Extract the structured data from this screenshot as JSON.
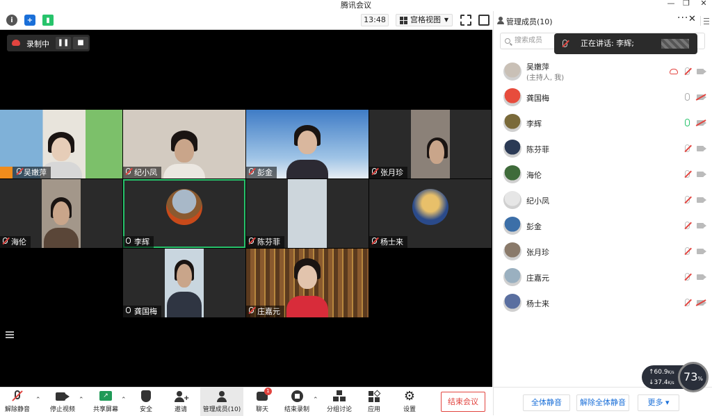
{
  "window": {
    "title": "腾讯会议",
    "controls": [
      "—",
      "❐",
      "✕"
    ]
  },
  "topbar": {
    "time": "13:48",
    "view_label": "宫格视图"
  },
  "recording": {
    "label": "录制中"
  },
  "tiles": [
    {
      "name": "吴嫩萍",
      "mic": "off",
      "bg": "#b7c9d6",
      "body": "#d7d7d7"
    },
    {
      "name": "纪小凤",
      "mic": "off",
      "bg": "#cfc7bd",
      "body": "#e3e0da"
    },
    {
      "name": "彭金",
      "mic": "off",
      "bg": "#4b86c9",
      "body": "#2c2a33"
    },
    {
      "name": "张月珍",
      "mic": "off",
      "bg": "#7f7f7f",
      "body": "#3a3432"
    },
    {
      "name": "海伦",
      "mic": "off",
      "bg": "#9a8f82",
      "body": "#5a4638"
    },
    {
      "name": "李辉",
      "mic": "on",
      "bg": "#2a2a2a",
      "body": "#000"
    },
    {
      "name": "陈芬菲",
      "mic": "off",
      "bg": "#cdd6dc",
      "body": "#cdd6dc"
    },
    {
      "name": "杨士来",
      "mic": "off",
      "bg": "#2a2a2a",
      "body": "#000"
    },
    {
      "name": "龚国梅",
      "mic": "on",
      "bg": "#c9d6df",
      "body": "#2f3542"
    },
    {
      "name": "庄嘉元",
      "mic": "off",
      "bg": "#6b4a2d",
      "body": "#d82c3a"
    }
  ],
  "bottombar": {
    "unmute": "解除静音",
    "stop_video": "停止视频",
    "share_screen": "共享屏幕",
    "security": "安全",
    "invite": "邀请",
    "manage_members": "管理成员(10)",
    "chat": "聊天",
    "chat_badge": "1",
    "stop_recording": "结束录制",
    "breakout": "分组讨论",
    "apps": "应用",
    "settings": "设置",
    "end_meeting": "结束会议"
  },
  "panel": {
    "title": "管理成员(10)",
    "search_placeholder": "搜索成员",
    "speaking": "正在讲话: 李辉;",
    "members": [
      {
        "name": "吴嫩萍",
        "sub": "(主持人, 我)",
        "mic": "off",
        "cam": "plain",
        "rec": true,
        "color": "#c9c0b6"
      },
      {
        "name": "龚国梅",
        "sub": "",
        "mic": "grey",
        "cam": "off",
        "rec": false,
        "color": "#e74c3c"
      },
      {
        "name": "李辉",
        "sub": "",
        "mic": "green",
        "cam": "off",
        "rec": false,
        "color": "#7a6a3a"
      },
      {
        "name": "陈芬菲",
        "sub": "",
        "mic": "off",
        "cam": "plain",
        "rec": false,
        "color": "#2b3a55"
      },
      {
        "name": "海伦",
        "sub": "",
        "mic": "off",
        "cam": "plain",
        "rec": false,
        "color": "#3f6b3a"
      },
      {
        "name": "纪小凤",
        "sub": "",
        "mic": "off",
        "cam": "plain",
        "rec": false,
        "color": "#e6e6e6"
      },
      {
        "name": "彭金",
        "sub": "",
        "mic": "off",
        "cam": "plain",
        "rec": false,
        "color": "#3c6fa8"
      },
      {
        "name": "张月珍",
        "sub": "",
        "mic": "off",
        "cam": "plain",
        "rec": false,
        "color": "#8a7a6a"
      },
      {
        "name": "庄嘉元",
        "sub": "",
        "mic": "off",
        "cam": "plain",
        "rec": false,
        "color": "#9ab0c0"
      },
      {
        "name": "杨士来",
        "sub": "",
        "mic": "off",
        "cam": "off",
        "rec": false,
        "color": "#5a6fa0"
      }
    ],
    "mute_all": "全体静音",
    "unmute_all": "解除全体静音",
    "more": "更多 ▾"
  },
  "network": {
    "upload": "60.9",
    "upload_unit": "K/s",
    "download": "37.4",
    "download_unit": "K/s",
    "percent": "73",
    "percent_unit": "%"
  }
}
